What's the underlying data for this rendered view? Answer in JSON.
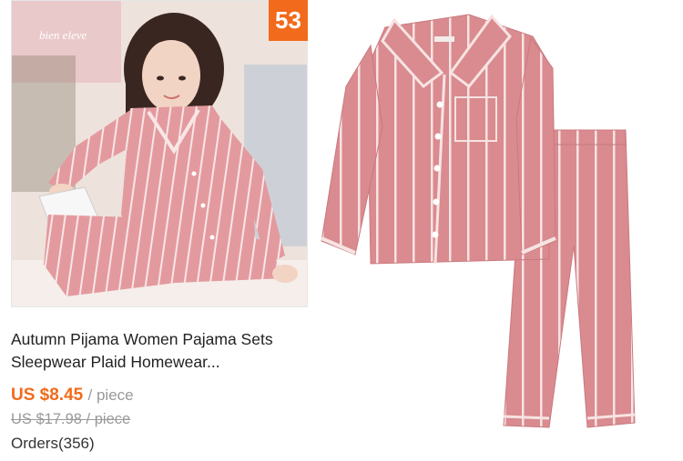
{
  "listing": {
    "discount_badge": "53",
    "watermark": "bien eleve",
    "title": "Autumn Pijama Women Pajama Sets Sleepwear Plaid Homewear...",
    "price": "US $8.45",
    "price_unit": "/ piece",
    "original_price": "US $17.98 / piece",
    "orders": "Orders(356)"
  },
  "colors": {
    "accent": "#f26a1b",
    "pajama": "#d98b8f",
    "stripe": "#f7e3e2"
  },
  "icons": []
}
